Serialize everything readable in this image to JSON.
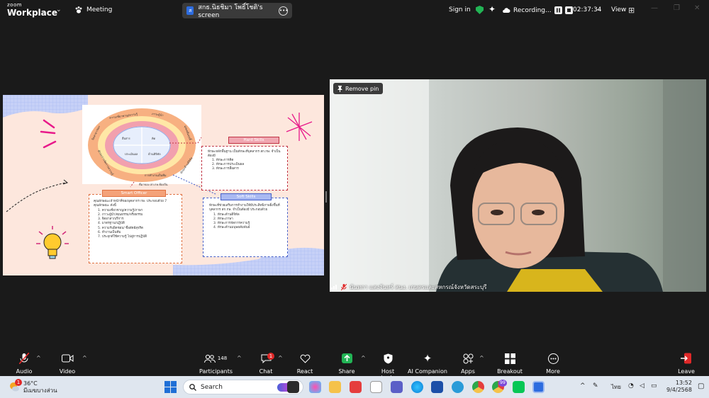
{
  "app": {
    "brand_top": "zoom",
    "brand_bottom": "Workplace",
    "meeting_label": "Meeting"
  },
  "share_pill": {
    "avatar_letter": "ส",
    "label": "สกธ.นิธชิมา  โพธิ์โชติ's screen"
  },
  "status": {
    "sign_in": "Sign in",
    "recording_label": "Recording...",
    "timer": "02:37:34",
    "view_label": "View"
  },
  "slide": {
    "outer_ring": [
      "ความเชี่ยวชาญ/ความรู้",
      "ภาวะผู้นำ",
      "จิตสาธารณะ",
      "มุ่งผลสัมฤทธิ์",
      "ทักษะการจัดการความรู้",
      "ทักษะด้านดิจิทัล",
      "การทำงานเป็นทีม"
    ],
    "inner_quads": [
      "สื่อสาร",
      "คิด",
      "ประเมินผล",
      "ด้านดิจิทัล"
    ],
    "chart_caption": "ที่มาของ สก.กษ.ท้องถิ่น",
    "hard_skills": {
      "title": "Hard Skills",
      "desc": "ทักษะหลักพื้นฐาน เป็นทักษะที่บุคลากร สก.กษ. จำเป็นต้องมี",
      "items": [
        "1. ทักษะการคิด",
        "2. ทักษะการประเมินผล",
        "3. ทักษะการสื่อสาร"
      ]
    },
    "smart_officer": {
      "title": "Smart Officer",
      "desc": "คุณลักษณะเจ้าหน้าที่ของบุคลากร กษ. ประกอบด้วย 7 คุณลักษณะ ดังนี้",
      "items": [
        "1. ความเชี่ยวชาญ/ความรู้/ภาษา",
        "2. ภาวะผู้นำ/คุณธรรม/จริยธรรม",
        "3. จิตอาสา/บริการ",
        "4. มาตรฐาน/ปฏิบัติ",
        "5. ความรับผิดชอบ/ ซื่อสัตย์สุจริต",
        "6. ทำงานเป็นทีม",
        "7. ประยุกต์ใช้ความรู้ ไปสู่การปฏิบัติ"
      ]
    },
    "soft_skills": {
      "title": "Soft Skills",
      "desc": "ทักษะที่ช่วยเสริมการทำงานให้มีประสิทธิภาพยิ่งขึ้นที่บุคลากร สก.กษ. จำเป็นต้องมี ประกอบด้วย",
      "items": [
        "1. ทักษะด้านดิจิทัล",
        "2. ทักษะภาษา",
        "3. ทักษะการจัดการความรู้",
        "4. ทักษะด้านมนุษยสัมพันธ์"
      ]
    }
  },
  "video": {
    "remove_pin": "Remove pin",
    "participant_name": "นันทกา แสงจันทร์ สนง. เกษตรและสหกรณ์จังหวัดสระบุรี"
  },
  "toolbar": {
    "audio": "Audio",
    "video": "Video",
    "participants": "Participants",
    "participants_count": "148",
    "chat": "Chat",
    "chat_badge": "1",
    "react": "React",
    "share": "Share",
    "host_tools": "Host tools",
    "ai_companion": "AI Companion",
    "apps": "Apps",
    "breakout": "Breakout rooms",
    "more": "More",
    "leave": "Leave"
  },
  "taskbar": {
    "weather_badge": "1",
    "temp": "36°C",
    "condition": "มีเมฆบางส่วน",
    "search": "Search",
    "lang": "ไทย",
    "time": "13:52",
    "date": "9/4/2568",
    "teams_badge": "99"
  },
  "colors": {
    "accent_green": "#22b455",
    "slide_bg": "#fde7dd",
    "hard_title": "#f0a7b1",
    "smart_title": "#f4a279",
    "soft_title": "#a9b9f2"
  }
}
